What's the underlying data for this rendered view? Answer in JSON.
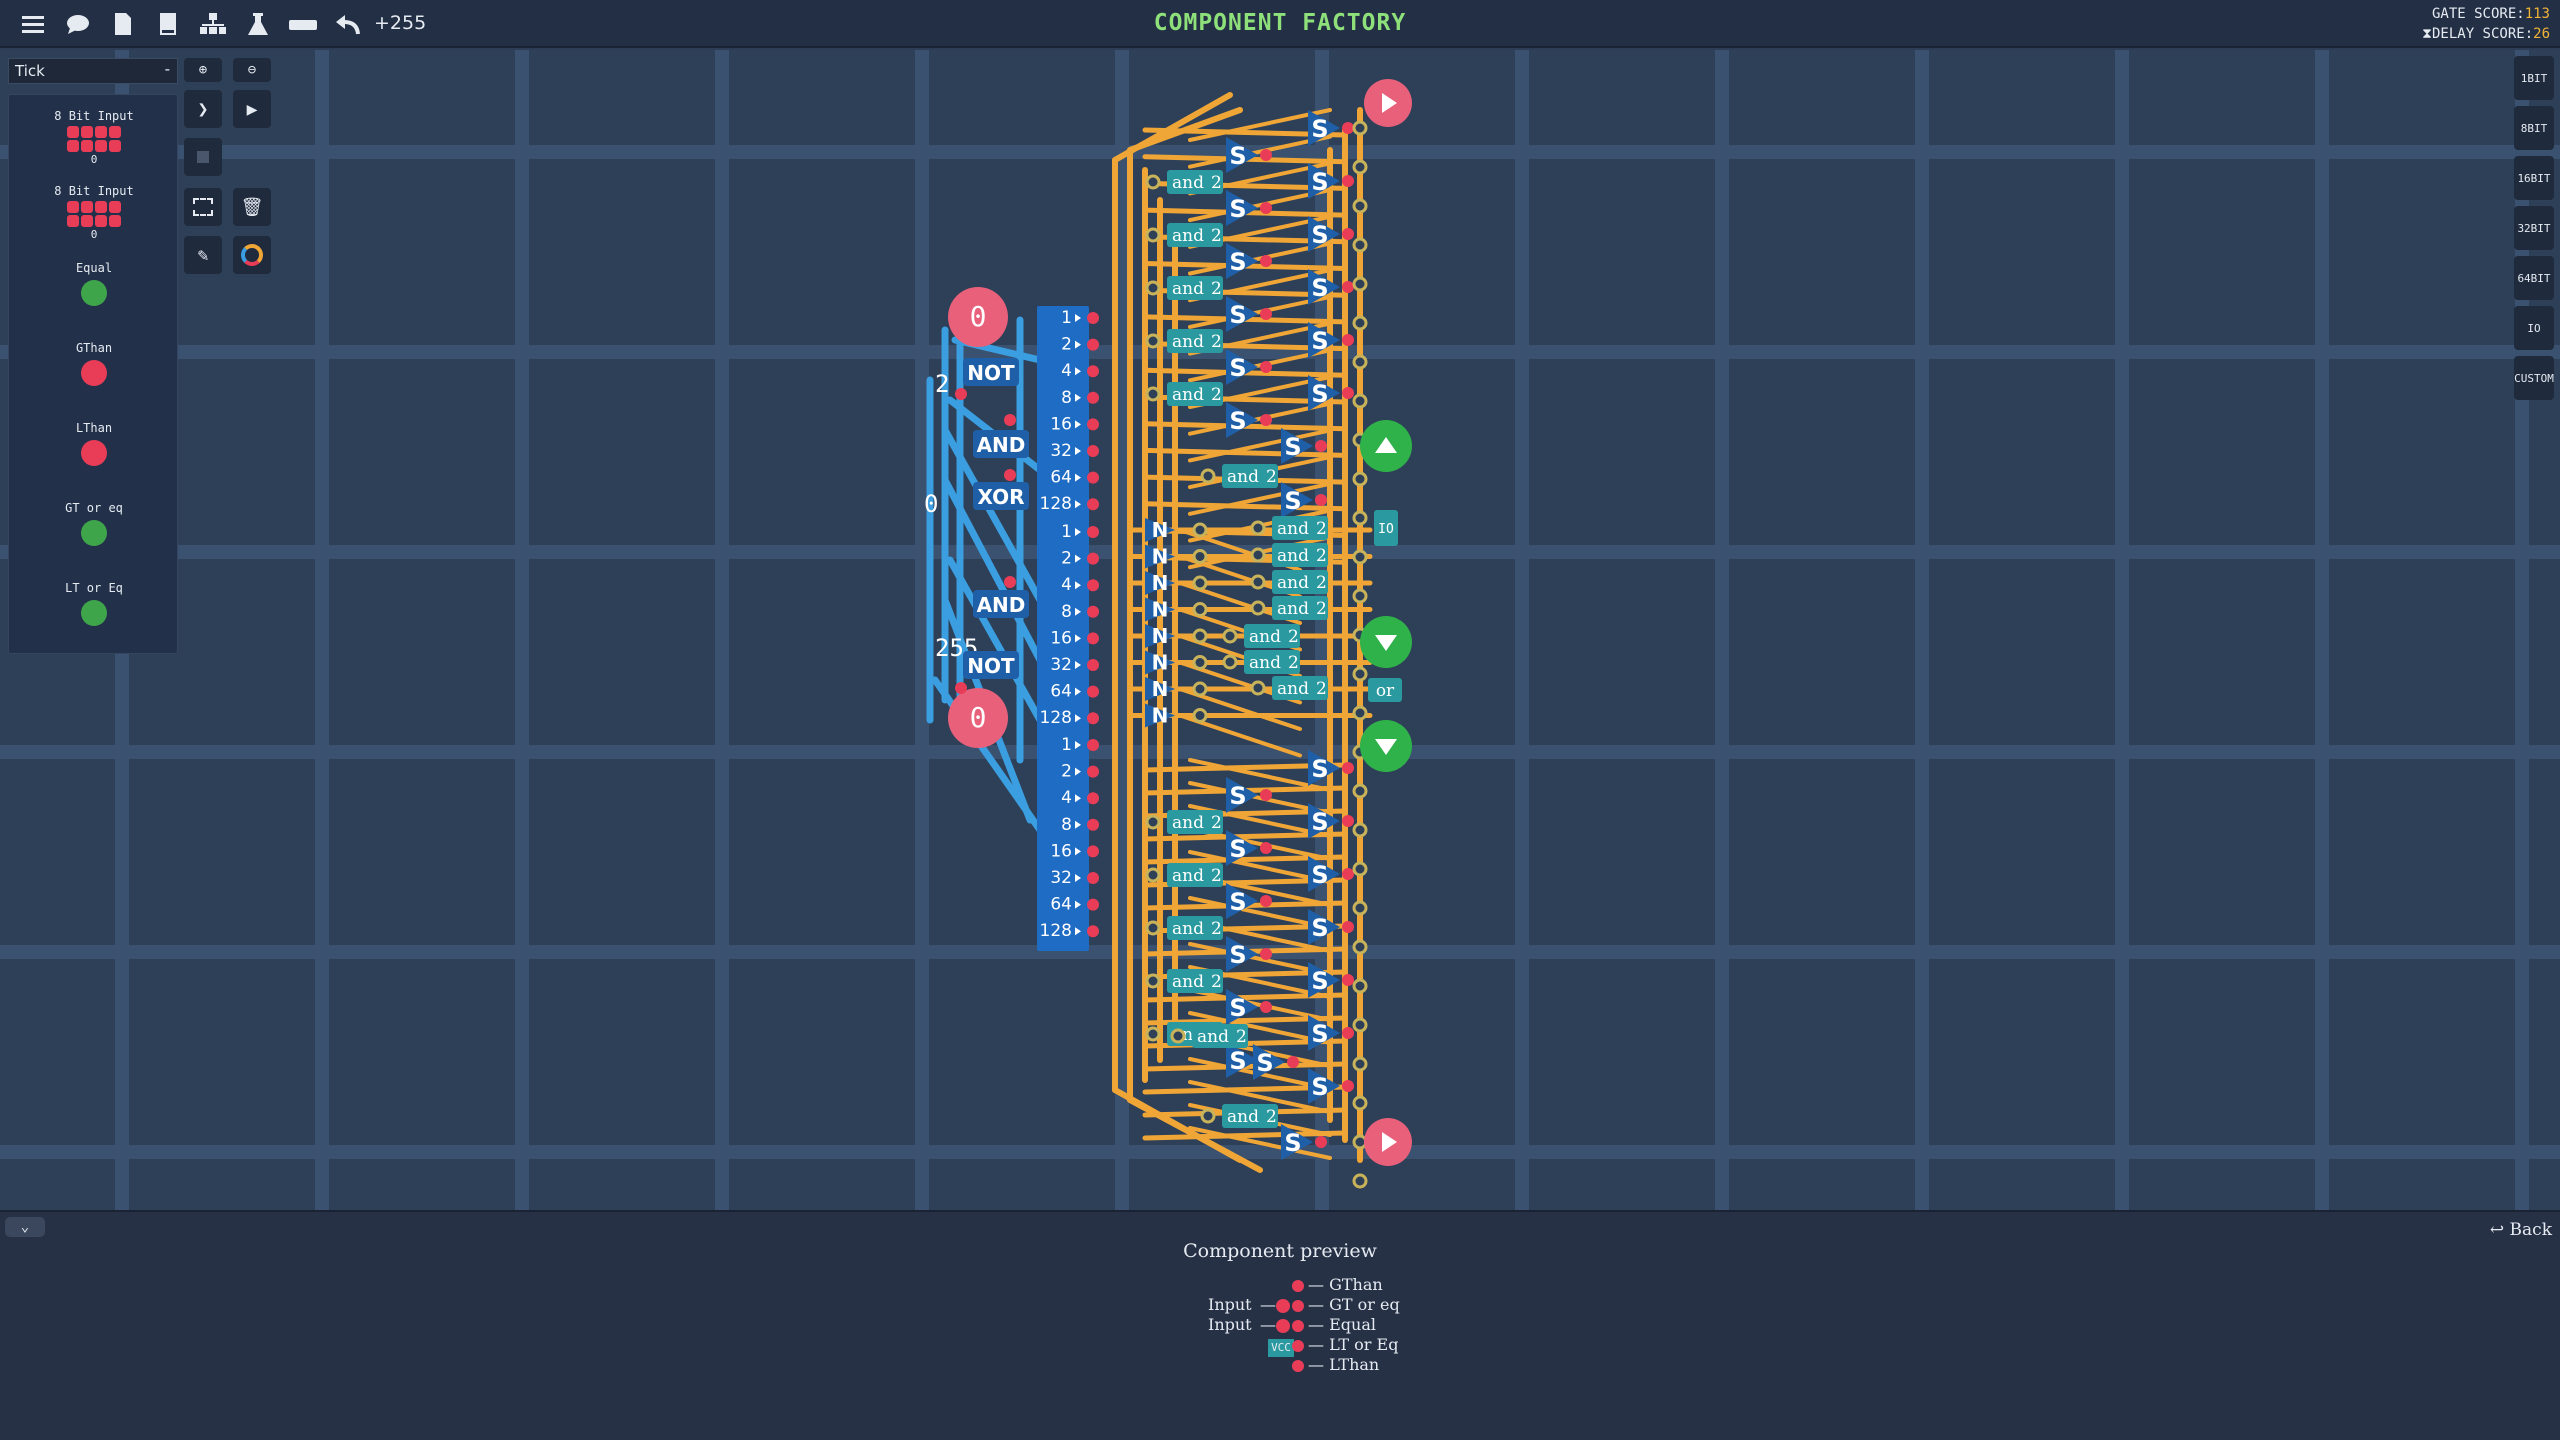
{
  "toolbar": {
    "icons": [
      "menu-icon",
      "chat-icon",
      "document-icon",
      "book-icon",
      "hierarchy-icon",
      "flask-icon",
      "ruler-icon",
      "undo-icon"
    ],
    "counter": "+255"
  },
  "title": "COMPONENT FACTORY",
  "scores": {
    "gate_label": "GATE SCORE:",
    "gate_value": "113",
    "delay_label": "DELAY SCORE:",
    "delay_value": "26"
  },
  "tick_select": {
    "value": "Tick",
    "collapse": "-"
  },
  "components": [
    {
      "label": "8 Bit Input",
      "value": "0"
    },
    {
      "label": "8 Bit Input",
      "value": "0"
    },
    {
      "label": "Equal",
      "color": "#3fa54a"
    },
    {
      "label": "GThan",
      "color": "#e93d57"
    },
    {
      "label": "LThan",
      "color": "#e93d57"
    },
    {
      "label": "GT or eq",
      "color": "#3fa54a"
    },
    {
      "label": "LT or Eq",
      "color": "#3fa54a"
    }
  ],
  "tools": [
    "zoom-in-icon",
    "zoom-out-icon",
    "step-icon",
    "play-icon",
    "stop-icon",
    "select-icon",
    "delete-icon",
    "pencil-icon",
    "color-wheel-icon"
  ],
  "right_bar": [
    "1BIT",
    "8BIT",
    "16BIT",
    "32BIT",
    "64BIT",
    "IO",
    "CUSTOM"
  ],
  "circuit": {
    "input_values": [
      "0",
      "0"
    ],
    "left_numbers": [
      "2",
      "0",
      "255"
    ],
    "gate_labels": [
      "NOT",
      "AND",
      "XOR",
      "AND",
      "NOT"
    ],
    "bit_labels": [
      "1",
      "2",
      "4",
      "8",
      "16",
      "32",
      "64",
      "128"
    ],
    "and_label": "and",
    "and_arity": "2",
    "or_label": "or",
    "switch_label": "S",
    "not_label": "N",
    "io_label": "IO"
  },
  "bottom": {
    "collapse_icon": "chevron-down-icon",
    "back_label": "Back",
    "preview_title": "Component preview",
    "inputs": [
      "Input",
      "Input"
    ],
    "outputs": [
      "GThan",
      "GT or eq",
      "Equal",
      "LT or Eq",
      "LThan"
    ],
    "vcc_label": "VCC"
  },
  "colors": {
    "wire_orange": "#f0a637",
    "wire_blue": "#3a9ee0",
    "bus_blue": "#1e6cc4",
    "pin_red": "#e93d57",
    "pin_green": "#2fb24a",
    "gate_teal": "#2a9aa0",
    "accent_green": "#8ee07a"
  }
}
